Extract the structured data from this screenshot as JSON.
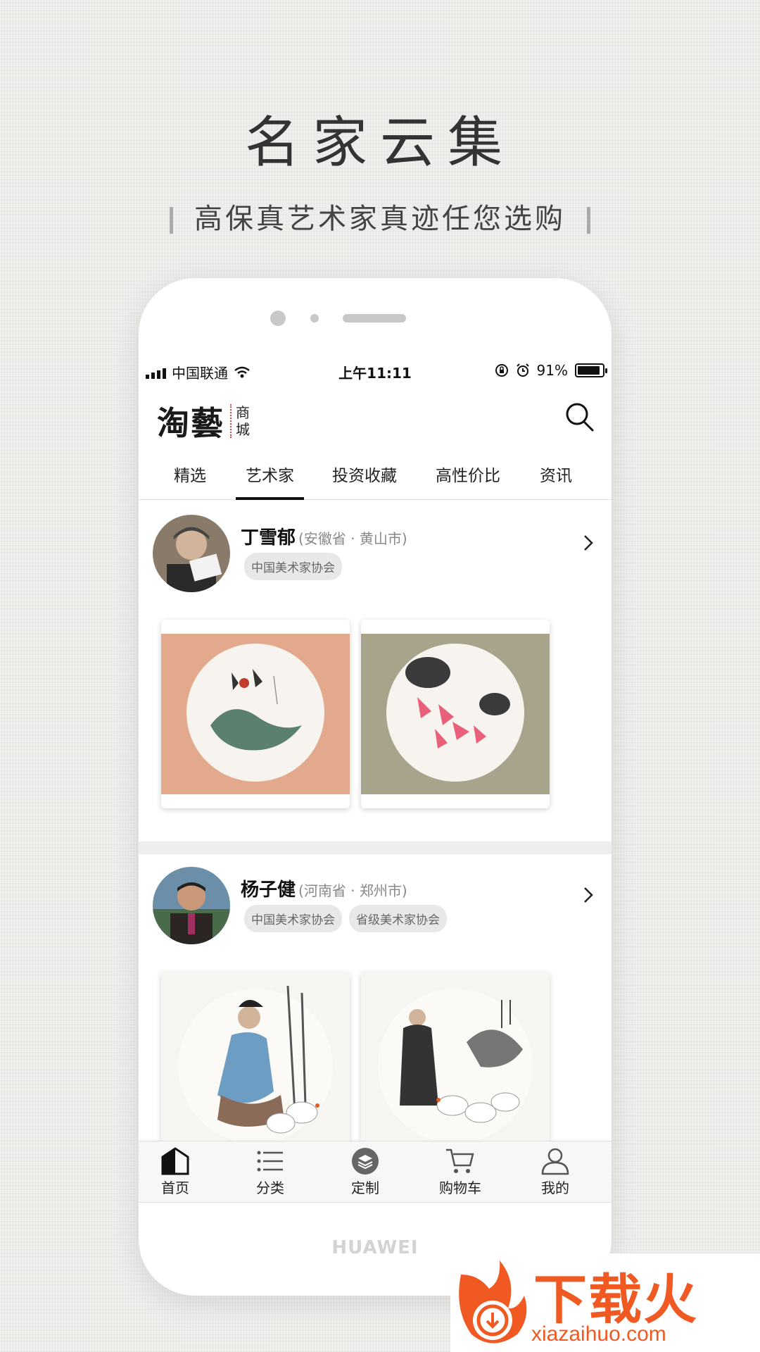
{
  "hero": {
    "title": "名家云集",
    "subtitle": "高保真艺术家真迹任您选购"
  },
  "status_bar": {
    "carrier": "中国联通",
    "time": "上午11:11",
    "battery": "91%"
  },
  "header": {
    "logo_main": "淘藝",
    "logo_sub_1": "商",
    "logo_sub_2": "城"
  },
  "tabs": [
    {
      "label": "精选"
    },
    {
      "label": "艺术家"
    },
    {
      "label": "投资收藏"
    },
    {
      "label": "高性价比"
    },
    {
      "label": "资讯"
    }
  ],
  "active_tab": "艺术家",
  "artists": [
    {
      "name": "丁雪郁",
      "location": "(安徽省 · 黄山市)",
      "tags": [
        "中国美术家协会"
      ]
    },
    {
      "name": "杨子健",
      "location": "(河南省 · 郑州市)",
      "tags": [
        "中国美术家协会",
        "省级美术家协会"
      ]
    }
  ],
  "tabbar": [
    {
      "label": "首页",
      "icon": "home-icon"
    },
    {
      "label": "分类",
      "icon": "list-icon"
    },
    {
      "label": "定制",
      "icon": "layers-icon"
    },
    {
      "label": "购物车",
      "icon": "cart-icon"
    },
    {
      "label": "我的",
      "icon": "user-icon"
    }
  ],
  "device_brand": "HUAWEI",
  "watermark": {
    "text": "下载火",
    "url": "xiazaihuo.com"
  },
  "colors": {
    "accent": "#111111",
    "watermark": "#f05a22",
    "tag_bg": "#e8e8e8"
  }
}
